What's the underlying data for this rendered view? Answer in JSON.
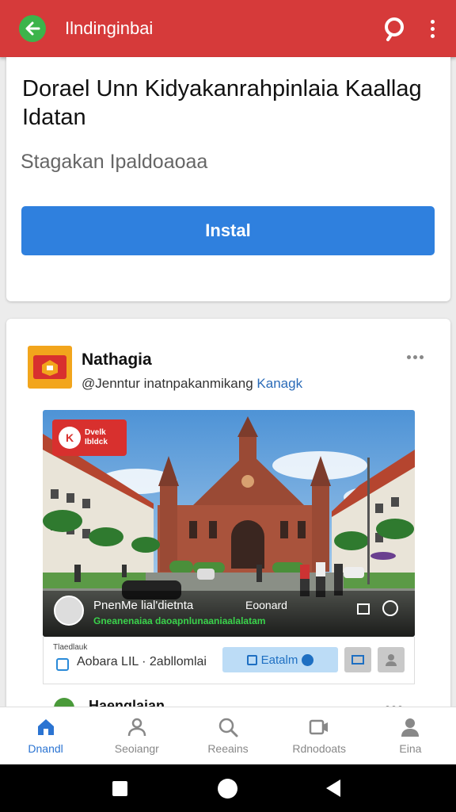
{
  "appbar": {
    "title": "Ilndinginbai",
    "color": "#d63a3a",
    "icons": [
      "back-arrow-icon",
      "search-icon",
      "more-vert-icon"
    ]
  },
  "install_card": {
    "title": "Dorael Unn Kidyakanrahpinlaia Kaallag Idatan",
    "subtitle": "Stagakan Ipaldoaoaa",
    "install_label": "Instal",
    "button_color": "#2f80de"
  },
  "post": {
    "publisher_name": "Nathagia",
    "publisher_handle": "@Jenntur inatnpakanmikang",
    "publisher_tag": "Kanagk",
    "media": {
      "badge_letter": "K",
      "badge_text_line1": "Dvelk",
      "badge_text_line2": "Ibldck",
      "overlay_title": "PnenMe lial'dietnta",
      "overlay_right": "Eoonard",
      "overlay_caption": "Gneanenaiaa daoapnlunaaniaalalatam"
    },
    "info": {
      "small_label": "Tlaedlauk",
      "text": "Aobara LIL · 2abllomlai",
      "button_label": "Eatalm"
    },
    "next_title": "Haenglaian"
  },
  "bottom_nav": {
    "items": [
      {
        "label": "Dnandl",
        "icon": "home-icon",
        "active": true
      },
      {
        "label": "Seoiangr",
        "icon": "person-icon",
        "active": false
      },
      {
        "label": "Reeains",
        "icon": "search-icon",
        "active": false
      },
      {
        "label": "Rdnodoats",
        "icon": "video-icon",
        "active": false
      },
      {
        "label": "Eina",
        "icon": "account-icon",
        "active": false
      }
    ],
    "active_color": "#2b74d2"
  },
  "system_nav": {
    "icons": [
      "recents-square-icon",
      "home-circle-icon",
      "back-triangle-icon"
    ]
  }
}
